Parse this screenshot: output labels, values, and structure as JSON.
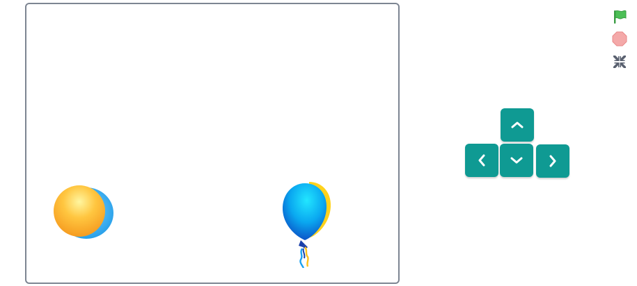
{
  "colors": {
    "stage_border": "#7d8592",
    "arrow_button": "#0f9a93",
    "flag": "#3fb24a",
    "stop": "#f4a9a9",
    "fullscreen": "#5a6170"
  },
  "stage": {
    "sprites": [
      {
        "name": "ball",
        "icon": "orange-ball-sprite"
      },
      {
        "name": "balloon",
        "icon": "blue-balloon-sprite"
      }
    ]
  },
  "controls": {
    "green_flag": "green-flag-icon",
    "stop": "stop-icon",
    "fullscreen": "exit-fullscreen-icon"
  },
  "arrow_keys": [
    "up",
    "left",
    "down",
    "right"
  ]
}
